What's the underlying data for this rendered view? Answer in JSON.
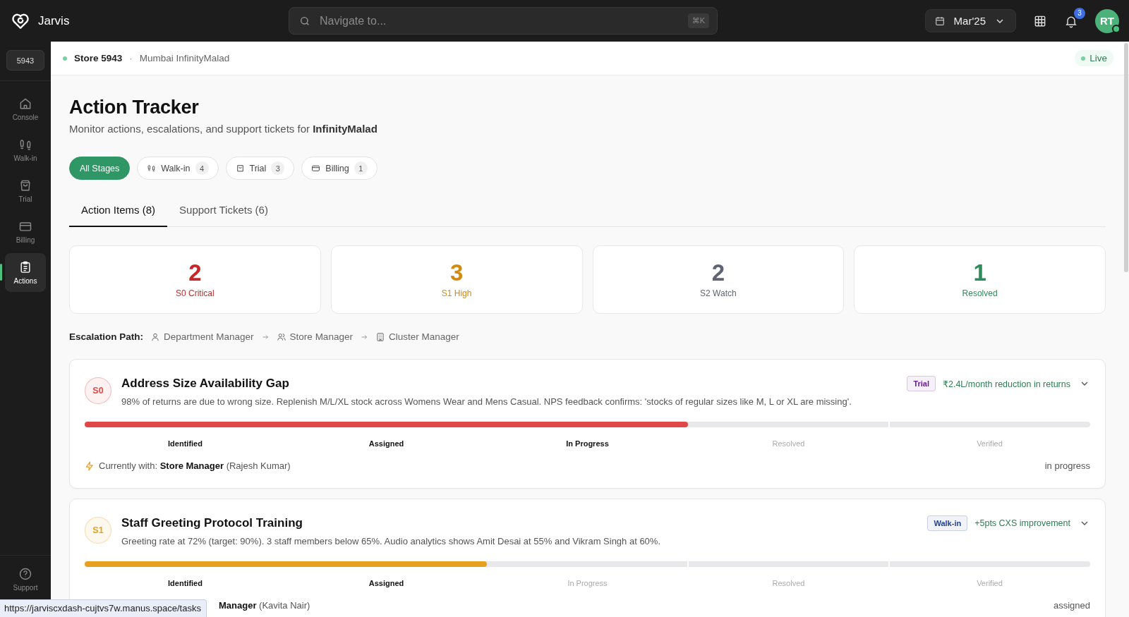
{
  "app": {
    "name": "Jarvis"
  },
  "search": {
    "placeholder": "Navigate to...",
    "shortcut": "⌘K"
  },
  "period": {
    "value": "Mar'25"
  },
  "notifications": {
    "count": "3"
  },
  "user": {
    "initials": "RT",
    "online": true
  },
  "sidebar": {
    "store_code": "5943",
    "items": [
      {
        "label": "Console",
        "selected": false
      },
      {
        "label": "Walk-in",
        "selected": false
      },
      {
        "label": "Trial",
        "selected": false
      },
      {
        "label": "Billing",
        "selected": false
      },
      {
        "label": "Actions",
        "selected": true
      }
    ],
    "footer": {
      "label": "Support"
    }
  },
  "store_bar": {
    "store": "Store 5943",
    "separator": "·",
    "location": "Mumbai InfinityMalad",
    "status": "Live"
  },
  "page": {
    "title": "Action Tracker",
    "subtitle": "Monitor actions, escalations, and support tickets for **InfinityMalad**"
  },
  "filters": [
    {
      "label": "All Stages",
      "selected": true
    },
    {
      "label": "Walk-in",
      "count": "4",
      "selected": false
    },
    {
      "label": "Trial",
      "count": "3",
      "selected": false
    },
    {
      "label": "Billing",
      "count": "1",
      "selected": false
    }
  ],
  "tabs": [
    {
      "label": "Action Items (8)",
      "selected": true
    },
    {
      "label": "Support Tickets (6)",
      "selected": false
    }
  ],
  "stats": [
    {
      "value": "2",
      "label": "S0 Critical",
      "color": "#c62828"
    },
    {
      "value": "3",
      "label": "S1 High",
      "color": "#d38a12"
    },
    {
      "value": "2",
      "label": "S2 Watch",
      "color": "#5f6472"
    },
    {
      "value": "1",
      "label": "Resolved",
      "color": "#2e8b5a"
    }
  ],
  "escalation_path": {
    "label": "Escalation Path:",
    "steps": [
      "Department Manager",
      "Store Manager",
      "Cluster Manager"
    ]
  },
  "action_items": [
    {
      "severity": "S0",
      "color": "#e04848",
      "title": "Address Size Availability Gap",
      "description": "98% of returns are due to wrong size. Replenish M/L/XL stock across Womens Wear and Mens Casual. NPS feedback confirms: 'stocks of regular sizes like M, L or XL are missing'.",
      "tag": {
        "label": "Trial",
        "color": "#6a1b9a"
      },
      "impact": "₹2.4L/month reduction in returns",
      "progress": {
        "level": 0.6
      },
      "stages": [
        {
          "label": "Identified",
          "reached": true
        },
        {
          "label": "Assigned",
          "reached": true
        },
        {
          "label": "In Progress",
          "reached": true
        },
        {
          "label": "Resolved",
          "reached": false
        },
        {
          "label": "Verified",
          "reached": false
        }
      ],
      "owner_label": "Currently with:",
      "owner_role": "Store Manager",
      "owner_name": "(Rajesh Kumar)",
      "status": "in progress"
    },
    {
      "severity": "S1",
      "color": "#e8a020",
      "title": "Staff Greeting Protocol Training",
      "description": "Greeting rate at 72% (target: 90%). 3 staff members below 65%. Audio analytics shows Amit Desai at 55% and Vikram Singh at 60%.",
      "tag": {
        "label": "Walk-in",
        "color": "#1e3f94"
      },
      "impact": "+5pts CXS improvement",
      "progress": {
        "level": 0.4
      },
      "stages": [
        {
          "label": "Identified",
          "reached": true
        },
        {
          "label": "Assigned",
          "reached": true
        },
        {
          "label": "In Progress",
          "reached": false
        },
        {
          "label": "Resolved",
          "reached": false
        },
        {
          "label": "Verified",
          "reached": false
        }
      ],
      "owner_role": "Manager",
      "owner_name": "(Kavita Nair)",
      "status": "assigned"
    }
  ],
  "status_tooltip": {
    "url": "https://jarviscxdash-cujtvs7w.manus.space/tasks"
  }
}
